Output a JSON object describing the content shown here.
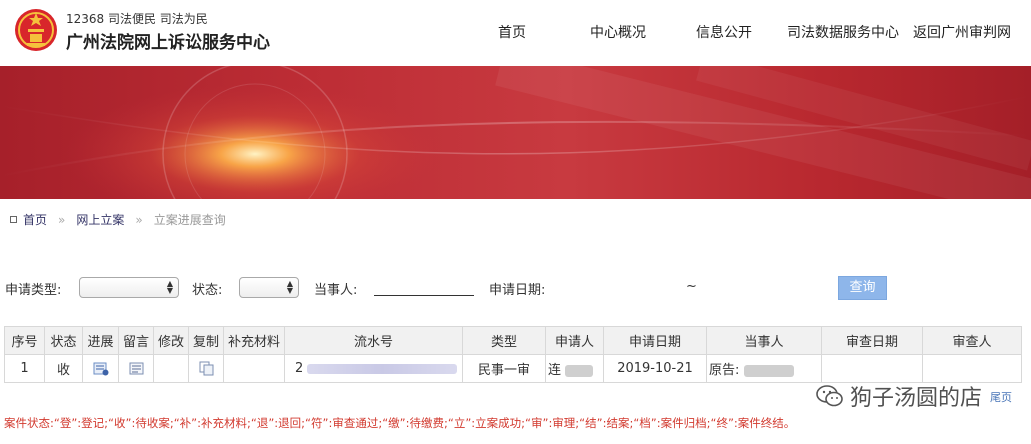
{
  "header": {
    "hotline": "12368 司法便民 司法为民",
    "title": "广州法院网上诉讼服务中心",
    "nav": [
      "首页",
      "中心概况",
      "信息公开",
      "司法数据服务中心",
      "返回广州审判网"
    ]
  },
  "breadcrumb": {
    "items": [
      "首页",
      "网上立案",
      "立案进展查询"
    ]
  },
  "search": {
    "type_label": "申请类型:",
    "status_label": "状态:",
    "party_label": "当事人:",
    "date_label": "申请日期:",
    "date_sep": "~",
    "query_button": "查询"
  },
  "table": {
    "headers": [
      "序号",
      "状态",
      "进展",
      "留言",
      "修改",
      "复制",
      "补充材料",
      "流水号",
      "类型",
      "申请人",
      "申请日期",
      "当事人",
      "审查日期",
      "审查人"
    ],
    "rows": [
      {
        "index": "1",
        "status": "收",
        "serial": "2",
        "type": "民事一审",
        "applicant": "连",
        "date": "2019-10-21",
        "party": "原告:",
        "review_date": "",
        "reviewer": ""
      }
    ]
  },
  "pager": {
    "last": "尾页"
  },
  "legend": "案件状态:“登”:登记;“收”:待收案;“补”:补充材料;“退”:退回;“符”:审查通过;“缴”:待缴费;“立”:立案成功;“审”:审理;“结”:结案;“档”:案件归档;“终”:案件终结。",
  "watermark": {
    "text": "狗子汤圆的店"
  },
  "colors": {
    "banner": "#bd2d35",
    "legend": "#d23a2f",
    "query_button": "#8eb6ea",
    "table_header": "#f1f1f1"
  }
}
